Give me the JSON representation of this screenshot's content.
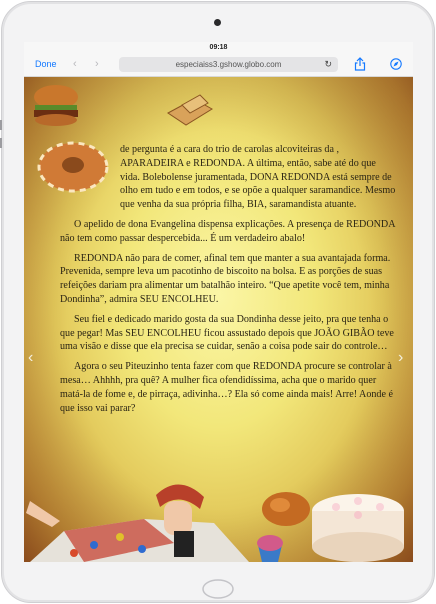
{
  "status": {
    "time": "09:18"
  },
  "toolbar": {
    "done_label": "Done",
    "back_icon": "chevron-left-icon",
    "forward_icon": "chevron-right-icon",
    "url": "especiaiss3.gshow.globo.com",
    "reload_icon": "reload-icon",
    "share_icon": "share-icon",
    "compass_icon": "compass-icon"
  },
  "content": {
    "paragraphs": [
      "de pergunta é a cara do trio de carolas alcoviteiras da , APARADEIRA e REDONDA. A última, então, sabe até do que vida. Bolebolense juramentada, DONA REDONDA está sempre de olho em tudo e em todos, e se opõe a qualquer saramandice. Mesmo que venha da sua própria filha, BIA, saramandista atuante.",
      "O apelido de dona Evangelina dispensa explicações. A presença de REDONDA não tem como passar despercebida... É um verdadeiro abalo!",
      "REDONDA não para de comer, afinal tem que manter a sua avantajada forma. Prevenida, sempre leva um pacotinho de biscoito na bolsa. E as porções de suas refeições dariam pra alimentar um batalhão inteiro. “Que apetite você tem, minha Dondinha”, admira SEU ENCOLHEU.",
      "Seu fiel e dedicado marido gosta da sua Dondinha desse jeito, pra que tenha o que pegar! Mas SEU ENCOLHEU ficou assustado depois que JOÃO GIBÃO teve uma visão e disse que ela precisa se cuidar, senão a coisa pode sair do controle…",
      "Agora o seu Piteuzinho tenta fazer com que REDONDA procure se controlar à mesa… Ahhhh, pra quê? A mulher fica ofendidíssima, acha que o marido quer matá-la de fome e, de pirraça, adivinha…? Ela só come ainda mais! Arre! Aonde é que isso vai parar?"
    ],
    "prev_icon": "chevron-left-icon",
    "next_icon": "chevron-right-icon"
  },
  "colors": {
    "link_blue": "#1479ff",
    "page_yellow": "#f2e77a",
    "page_edge": "#a45e26"
  }
}
